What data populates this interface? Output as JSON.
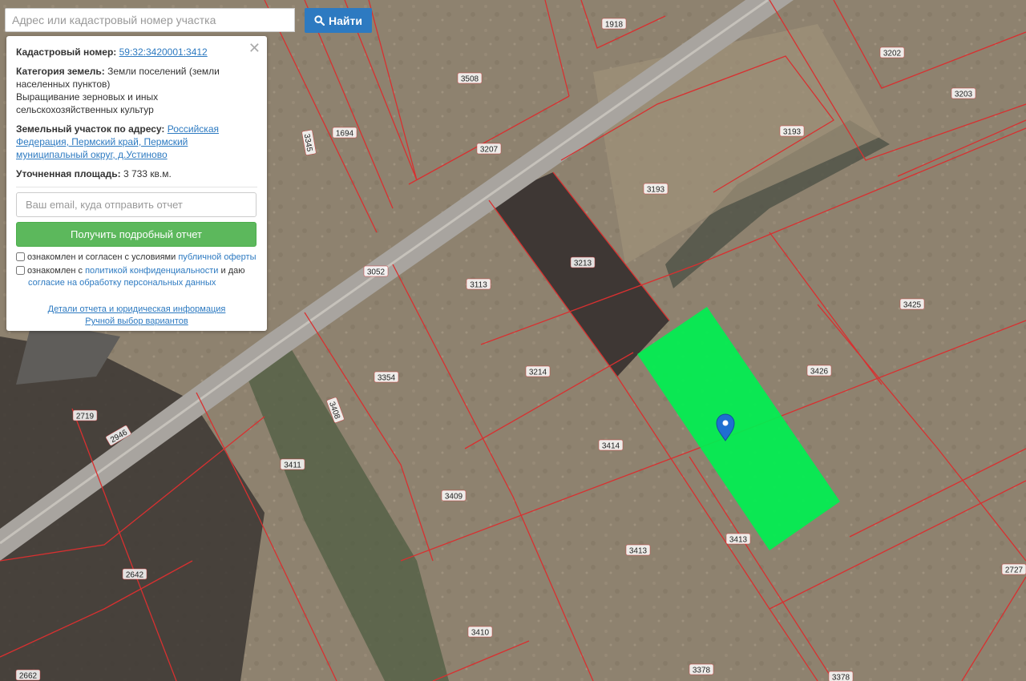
{
  "search": {
    "placeholder": "Адрес или кадастровый номер участка",
    "button_label": "Найти"
  },
  "info_panel": {
    "cadastral_label": "Кадастровый номер:",
    "cadastral_number": "59:32:3420001:3412",
    "category_label": "Категория земель:",
    "category_value": "Земли поселений (земли населенных пунктов)",
    "usage_value": "Выращивание зерновых и иных сельскохозяйственных культур",
    "address_label": "Земельный участок по адресу:",
    "address_value": "Российская Федерация, Пермский край, Пермский муниципальный округ, д.Устиново",
    "area_label": "Уточненная площадь:",
    "area_value": "3 733 кв.м.",
    "email_placeholder": "Ваш email, куда отправить отчет",
    "report_button": "Получить подробный отчет",
    "consent1_text": "ознакомлен и согласен с условиями ",
    "consent1_link": "публичной оферты",
    "consent2_text": "ознакомлен с ",
    "consent2_link": "политикой конфиденциальности",
    "consent2_mid": " и даю",
    "consent2_link2": "согласие на обработку персональных данных",
    "details_link": "Детали отчета и юридическая информация",
    "manual_link": "Ручной выбор вариантов"
  },
  "map": {
    "highlight_color": "#00f050",
    "boundary_color": "#d83030",
    "marker_color": "#1f6fd1",
    "parcel_labels": [
      "1918",
      "3202",
      "3203",
      "3508",
      "3193",
      "3193",
      "1694",
      "3345",
      "3207",
      "3213",
      "3052",
      "3113",
      "3425",
      "3426",
      "3214",
      "3354",
      "3408",
      "3414",
      "2719",
      "2946",
      "3411",
      "3409",
      "3413",
      "3413",
      "2642",
      "3410",
      "3378",
      "3378",
      "2727",
      "2662"
    ]
  }
}
